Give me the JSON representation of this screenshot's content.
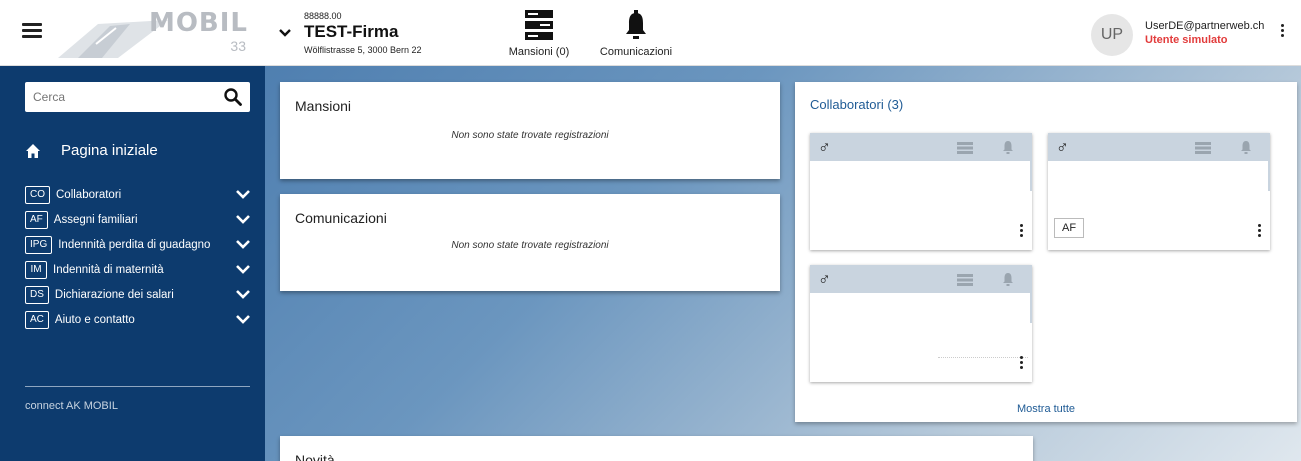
{
  "header": {
    "logo_text": "MOBIL",
    "logo_number": "33",
    "company": {
      "number": "88888.00",
      "name": "TEST-Firma",
      "address": "Wölflistrasse 5, 3000 Bern 22"
    },
    "nav": [
      {
        "label": "Mansioni (0)",
        "icon": "list-icon"
      },
      {
        "label": "Comunicazioni",
        "icon": "bell-icon"
      }
    ],
    "user": {
      "initials": "UP",
      "email": "UserDE@partnerweb.ch",
      "status": "Utente simulato"
    }
  },
  "sidebar": {
    "search_placeholder": "Cerca",
    "home_label": "Pagina iniziale",
    "items": [
      {
        "code": "CO",
        "label": "Collaboratori"
      },
      {
        "code": "AF",
        "label": "Assegni familiari"
      },
      {
        "code": "IPG",
        "label": "Indennità perdita di guadagno"
      },
      {
        "code": "IM",
        "label": "Indennità di maternità"
      },
      {
        "code": "DS",
        "label": "Dichiarazione dei salari"
      },
      {
        "code": "AC",
        "label": "Aiuto e contatto"
      }
    ],
    "footer": "connect AK MOBIL"
  },
  "main": {
    "mansioni": {
      "title": "Mansioni",
      "empty": "Non sono state trovate registrazioni"
    },
    "comunicazioni": {
      "title": "Comunicazioni",
      "empty": "Non sono state trovate registrazioni"
    },
    "novita": {
      "title": "Novità"
    },
    "collaboratori": {
      "title": "Collaboratori (3)",
      "cards": [
        {
          "gender_symbol": "♂",
          "badge": ""
        },
        {
          "gender_symbol": "♂",
          "badge": "AF"
        },
        {
          "gender_symbol": "♂",
          "badge": ""
        }
      ],
      "show_all": "Mostra tutte"
    }
  },
  "colors": {
    "sidebar_bg": "#0d3b6e",
    "accent_blue": "#1f5b95",
    "alert_red": "#e23b3b"
  }
}
